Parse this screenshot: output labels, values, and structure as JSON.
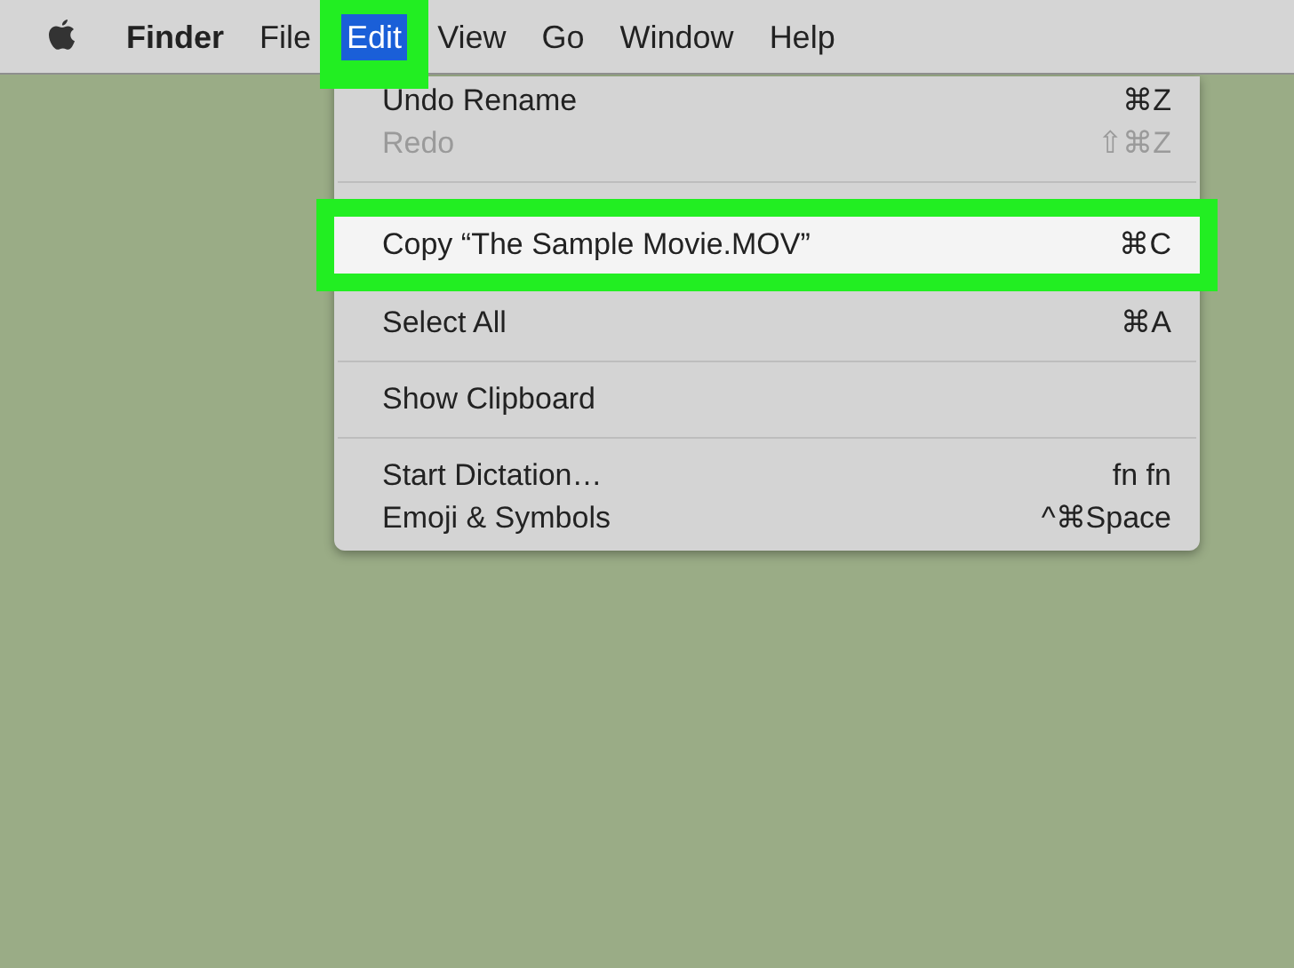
{
  "menu_bar": {
    "items": [
      {
        "label": "Finder",
        "kind": "app",
        "selected": false,
        "highlighted": false
      },
      {
        "label": "File",
        "kind": "menu",
        "selected": false,
        "highlighted": false
      },
      {
        "label": "Edit",
        "kind": "menu",
        "selected": true,
        "highlighted": true
      },
      {
        "label": "View",
        "kind": "menu",
        "selected": false,
        "highlighted": false
      },
      {
        "label": "Go",
        "kind": "menu",
        "selected": false,
        "highlighted": false
      },
      {
        "label": "Window",
        "kind": "menu",
        "selected": false,
        "highlighted": false
      },
      {
        "label": "Help",
        "kind": "menu",
        "selected": false,
        "highlighted": false
      }
    ]
  },
  "edit_menu": {
    "items": [
      {
        "kind": "item",
        "label": "Undo Rename",
        "shortcut": "⌘Z",
        "disabled": false,
        "highlighted": false
      },
      {
        "kind": "item",
        "label": "Redo",
        "shortcut": "⇧⌘Z",
        "disabled": true,
        "highlighted": false
      },
      {
        "kind": "separator"
      },
      {
        "kind": "item",
        "label": "Copy “The Sample Movie.MOV”",
        "shortcut": "⌘C",
        "disabled": false,
        "highlighted": true
      },
      {
        "kind": "item",
        "label": "Select All",
        "shortcut": "⌘A",
        "disabled": false,
        "highlighted": false
      },
      {
        "kind": "separator"
      },
      {
        "kind": "item",
        "label": "Show Clipboard",
        "disabled": false,
        "highlighted": false
      },
      {
        "kind": "separator"
      },
      {
        "kind": "item",
        "label": "Start Dictation…",
        "shortcut": "fn fn",
        "disabled": false,
        "highlighted": false
      },
      {
        "kind": "item",
        "label": "Emoji & Symbols",
        "shortcut": "^⌘Space",
        "disabled": false,
        "highlighted": false
      }
    ]
  }
}
